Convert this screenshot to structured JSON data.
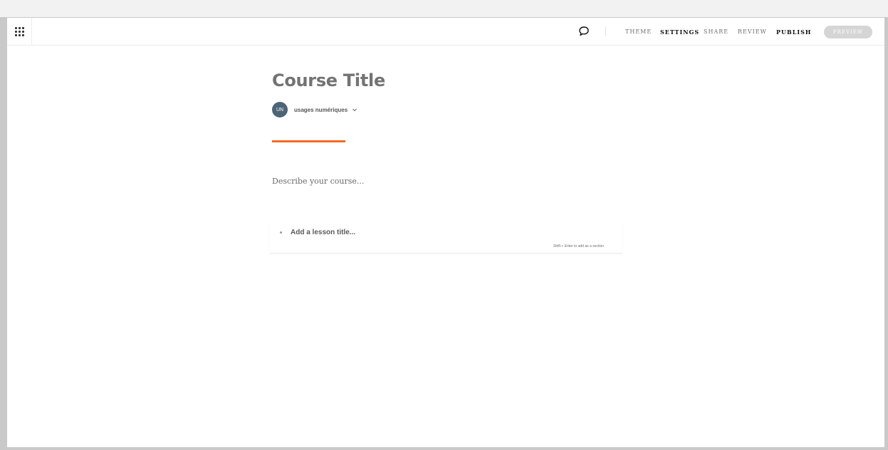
{
  "topbar": {
    "apps_icon": "grid-dots-icon",
    "comment_icon": "speech-bubble-icon",
    "nav": {
      "theme": "THEME",
      "settings": "SETTINGS",
      "share": "SHARE",
      "review": "REVIEW",
      "publish": "PUBLISH"
    },
    "preview": "PREVIEW"
  },
  "course": {
    "title": "Course Title",
    "author": {
      "initials": "UN",
      "name": "usages numériques",
      "chevron_icon": "chevron-down-icon"
    },
    "description_placeholder": "Describe your course...",
    "lesson": {
      "placeholder": "Add a lesson title...",
      "hint": "Shift + Enter to add as a section"
    }
  },
  "colors": {
    "accent": "#f36a21",
    "avatar": "#4d6477",
    "preview_button": "#d5d5d5"
  }
}
